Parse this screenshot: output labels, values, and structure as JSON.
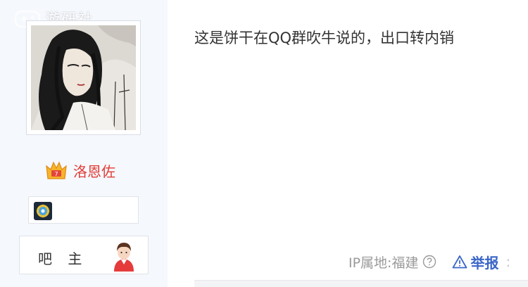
{
  "watermark": {
    "text": "游研社",
    "icon": "gamepad-icon"
  },
  "user": {
    "name": "洛恩佐",
    "name_color": "#e13b35",
    "avatar": "ink-painting-avatar",
    "level_icon": "crown-icon",
    "badge_icon": "gear-badge-icon",
    "role": "吧 主",
    "role_icon": "bar-owner-icon"
  },
  "post": {
    "text": "这是饼干在QQ群吹牛说的，出口转内销"
  },
  "meta": {
    "ip_location": "IP属地:福建",
    "help_icon": "question-circle-icon",
    "report_label": "举报",
    "report_icon": "warning-triangle-icon",
    "link_color": "#3a66c8"
  },
  "colors": {
    "sidebar_bg": "#f5f8fd",
    "content_bg": "#ffffff",
    "text": "#333333",
    "muted": "#9a9a9a"
  }
}
